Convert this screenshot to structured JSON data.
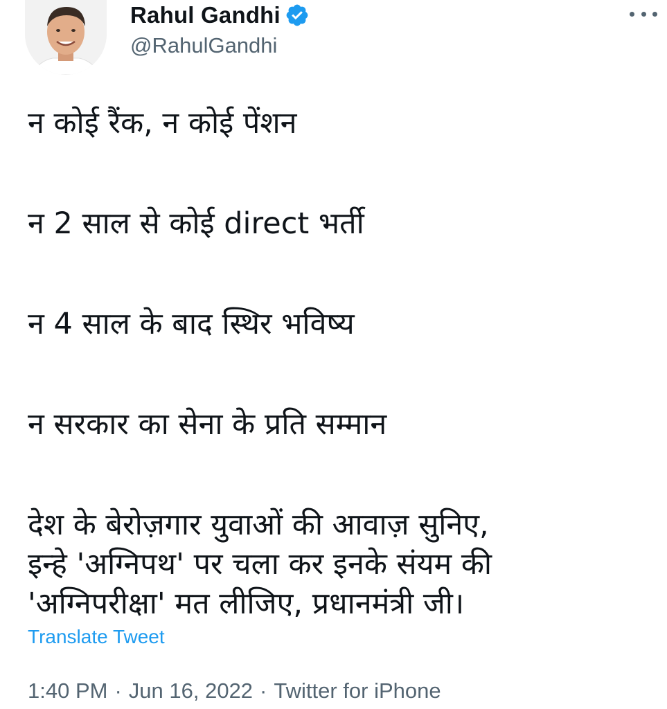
{
  "author": {
    "display_name": "Rahul Gandhi",
    "handle": "@RahulGandhi",
    "verified": true
  },
  "more_icon": "more-horizontal-icon",
  "body": {
    "paragraphs": [
      [
        "न कोई रैंक, न कोई पेंशन"
      ],
      [
        "न 2 साल से कोई direct भर्ती"
      ],
      [
        "न 4 साल के बाद स्थिर भविष्य"
      ],
      [
        "न सरकार का सेना के प्रति सम्मान"
      ],
      [
        "देश के बेरोज़गार युवाओं की आवाज़ सुनिए,",
        "इन्हे 'अग्निपथ' पर चला कर इनके संयम की",
        "'अग्निपरीक्षा' मत लीजिए, प्रधानमंत्री जी।"
      ]
    ]
  },
  "translate_label": "Translate Tweet",
  "meta": {
    "time": "1:40 PM",
    "date": "Jun 16, 2022",
    "source": "Twitter for iPhone",
    "separator": "·"
  },
  "colors": {
    "accent": "#1d9bf0",
    "secondary_text": "#536471",
    "primary_text": "#0f1419"
  }
}
